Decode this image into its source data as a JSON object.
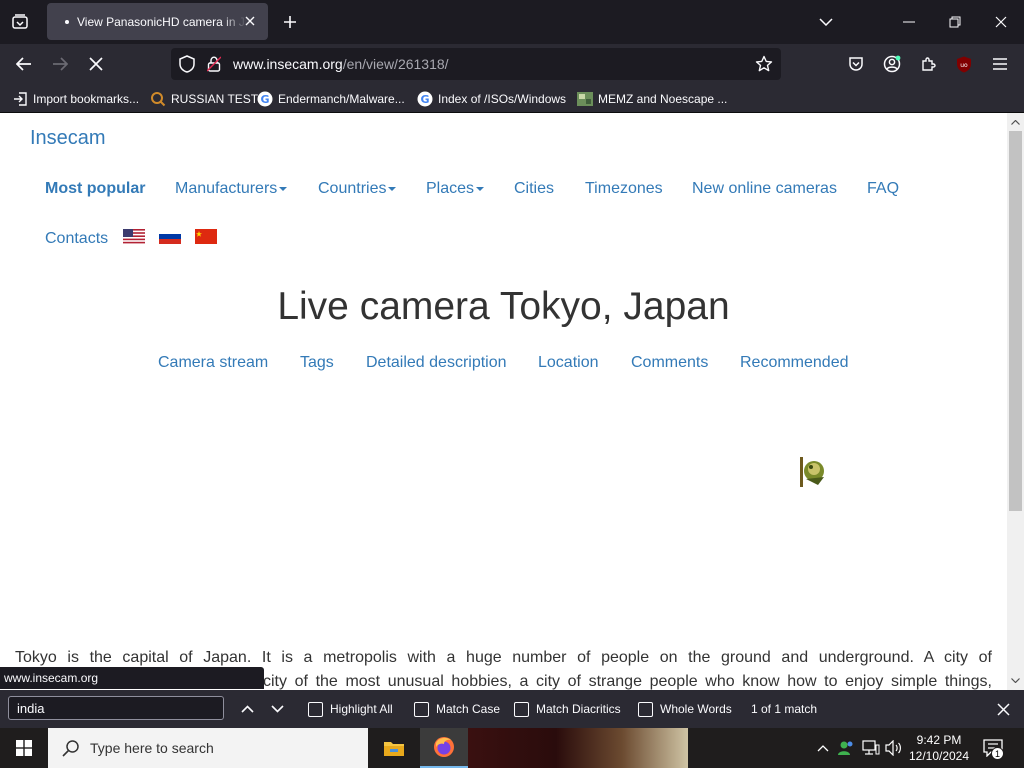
{
  "browser": {
    "tab": {
      "title": "View PanasonicHD camera in Japan"
    },
    "url": {
      "host": "www.insecam.org",
      "path": "/en/view/261318/"
    },
    "bookmarks": [
      {
        "label": "Import bookmarks...",
        "icon": "import-icon"
      },
      {
        "label": "RUSSIAN TEST",
        "icon": "search-icon"
      },
      {
        "label": "Endermanch/Malware...",
        "icon": "google-icon"
      },
      {
        "label": "Index of /ISOs/Windows",
        "icon": "google-icon"
      },
      {
        "label": "MEMZ and Noescape ...",
        "icon": "image-icon"
      }
    ],
    "status_tip": "www.insecam.org"
  },
  "page": {
    "brand": "Insecam",
    "menu": {
      "most_popular": "Most popular",
      "manufacturers": "Manufacturers",
      "countries": "Countries",
      "places": "Places",
      "cities": "Cities",
      "timezones": "Timezones",
      "new_cameras": "New online cameras",
      "faq": "FAQ",
      "contacts": "Contacts"
    },
    "flags": [
      "us-flag",
      "ru-flag",
      "cn-flag"
    ],
    "heading": "Live camera Tokyo, Japan",
    "sub_links": {
      "camera_stream": "Camera stream",
      "tags": "Tags",
      "description": "Detailed description",
      "location": "Location",
      "comments": "Comments",
      "recommended": "Recommended"
    },
    "description_line1": "Tokyo is the capital of Japan. It is a metropolis with a huge number of people on the ground and underground. A city of",
    "description_line2": "city of the most unusual hobbies, a city of strange people who know how to enjoy simple things,"
  },
  "findbar": {
    "query": "india",
    "highlight_all": "Highlight All",
    "match_case": "Match Case",
    "match_diacritics": "Match Diacritics",
    "whole_words": "Whole Words",
    "status": "1 of 1 match"
  },
  "taskbar": {
    "search_placeholder": "Type here to search",
    "time": "9:42 PM",
    "date": "12/10/2024",
    "notification_count": "1"
  },
  "colors": {
    "link": "#337ab7",
    "chrome_dark": "#1c1b22",
    "chrome": "#2b2a33",
    "tab_active": "#42414d"
  }
}
